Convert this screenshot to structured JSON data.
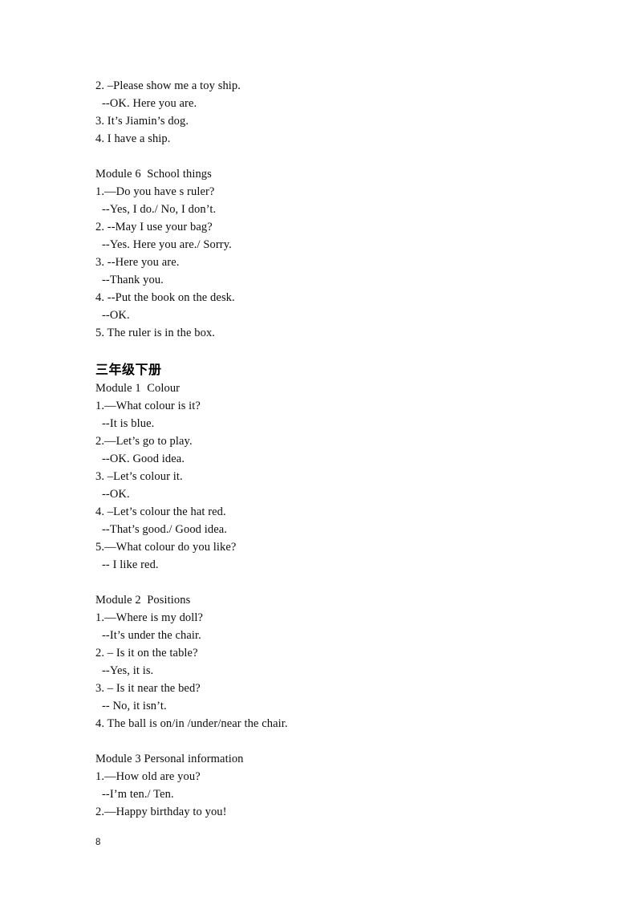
{
  "document": {
    "page_number": "8",
    "blocks": [
      {
        "type": "lines",
        "lines": [
          {
            "text": "2. –Please show me a toy ship.",
            "indent": false
          },
          {
            "text": "--OK. Here you are.",
            "indent": true
          },
          {
            "text": "3. It’s Jiamin’s dog.",
            "indent": false
          },
          {
            "text": "4. I have a ship.",
            "indent": false
          }
        ]
      },
      {
        "type": "spacer"
      },
      {
        "type": "lines",
        "lines": [
          {
            "text": "Module 6  School things",
            "indent": false,
            "module": true
          },
          {
            "text": "1.—Do you have s ruler?",
            "indent": false
          },
          {
            "text": "--Yes, I do./ No, I don’t.",
            "indent": true
          },
          {
            "text": "2. --May I use your bag?",
            "indent": false
          },
          {
            "text": "--Yes. Here you are./ Sorry.",
            "indent": true
          },
          {
            "text": "3. --Here you are.",
            "indent": false
          },
          {
            "text": "--Thank you.",
            "indent": true
          },
          {
            "text": "4. --Put the book on the desk.",
            "indent": false
          },
          {
            "text": "--OK.",
            "indent": true
          },
          {
            "text": "5. The ruler is in the box.",
            "indent": false
          }
        ]
      },
      {
        "type": "spacer"
      },
      {
        "type": "heading",
        "text": "三年级下册"
      },
      {
        "type": "lines",
        "lines": [
          {
            "text": "Module 1  Colour",
            "indent": false,
            "module": true
          },
          {
            "text": "1.—What colour is it?",
            "indent": false
          },
          {
            "text": "--It is blue.",
            "indent": true
          },
          {
            "text": "2.—Let’s go to play.",
            "indent": false
          },
          {
            "text": "--OK. Good idea.",
            "indent": true
          },
          {
            "text": "3. –Let’s colour it.",
            "indent": false
          },
          {
            "text": "--OK.",
            "indent": true
          },
          {
            "text": "4. –Let’s colour the hat red.",
            "indent": false
          },
          {
            "text": "--That’s good./ Good idea.",
            "indent": true
          },
          {
            "text": "5.—What colour do you like?",
            "indent": false
          },
          {
            "text": "-- I like red.",
            "indent": true
          }
        ]
      },
      {
        "type": "spacer"
      },
      {
        "type": "lines",
        "lines": [
          {
            "text": "Module 2  Positions",
            "indent": false,
            "module": true
          },
          {
            "text": "1.—Where is my doll?",
            "indent": false
          },
          {
            "text": "--It’s under the chair.",
            "indent": true
          },
          {
            "text": "2. – Is it on the table?",
            "indent": false
          },
          {
            "text": "--Yes, it is.",
            "indent": true
          },
          {
            "text": "3. – Is it near the bed?",
            "indent": false
          },
          {
            "text": "-- No, it isn’t.",
            "indent": true
          },
          {
            "text": "4. The ball is on/in /under/near the chair.",
            "indent": false
          }
        ]
      },
      {
        "type": "spacer"
      },
      {
        "type": "lines",
        "lines": [
          {
            "text": "Module 3 Personal information",
            "indent": false,
            "module": true
          },
          {
            "text": "1.—How old are you?",
            "indent": false
          },
          {
            "text": "--I’m ten./ Ten.",
            "indent": true
          },
          {
            "text": "2.—Happy birthday to you!",
            "indent": false
          }
        ]
      }
    ]
  }
}
